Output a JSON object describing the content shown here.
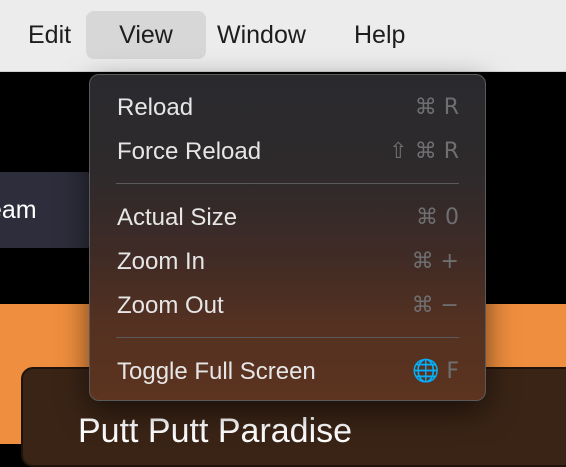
{
  "menubar": {
    "items": [
      {
        "label": "Edit"
      },
      {
        "label": "View",
        "active": true
      },
      {
        "label": "Window"
      },
      {
        "label": "Help"
      }
    ]
  },
  "background": {
    "team_tab_label": "eam",
    "card_title": "Putt Putt Paradise"
  },
  "view_menu": {
    "items": [
      {
        "label": "Reload",
        "shortcut": "⌘ R"
      },
      {
        "label": "Force Reload",
        "shortcut": "⇧ ⌘ R"
      },
      {
        "label": "Actual Size",
        "shortcut": "⌘ 0"
      },
      {
        "label": "Zoom In",
        "shortcut": "⌘ +"
      },
      {
        "label": "Zoom Out",
        "shortcut": "⌘ −"
      },
      {
        "label": "Toggle Full Screen",
        "shortcut": "🌐 F"
      }
    ]
  },
  "colors": {
    "menubar_bg": "#ececec",
    "menu_text": "#e6e6e6",
    "shortcut_text": "#6f6f72",
    "orange_band": "#ef8e3e",
    "card_bg": "#3a2416"
  }
}
